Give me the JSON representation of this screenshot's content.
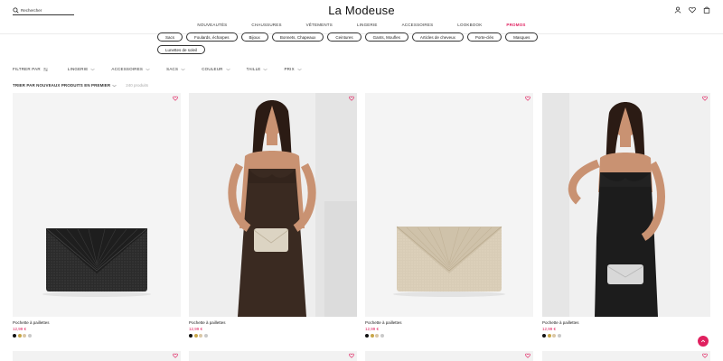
{
  "header": {
    "search_placeholder": "Rechercher",
    "logo": "La Modeuse",
    "nav": [
      "NOUVEAUTÉS",
      "CHAUSSURES",
      "VÊTEMENTS",
      "LINGERIE",
      "ACCESSOIRES",
      "LOOKBOOK",
      "PROMOS"
    ],
    "icons": [
      "account-icon",
      "heart-icon",
      "bag-icon"
    ]
  },
  "categories": [
    "Sacs",
    "Foulards, écharpes",
    "Bijoux",
    "Bonnets, Chapeaux",
    "Ceintures",
    "Gants, Moufles",
    "Articles de cheveux",
    "Porte-clés",
    "Masques",
    "Lunettes de soleil"
  ],
  "filters": {
    "label": "FILTRER PAR",
    "items": [
      "LINGERIE",
      "ACCESSOIRES",
      "SACS",
      "COULEUR",
      "TAILLE",
      "PRIX"
    ]
  },
  "sort": {
    "label": "TRIER PAR NOUVEAUX PRODUITS EN PREMIER",
    "count": "240 produits"
  },
  "products": [
    {
      "name": "Pochette à paillettes",
      "price": "12,99 €",
      "swatches": [
        "#111111",
        "#c8a648",
        "#d9c7a6",
        "#c9c9c9"
      ]
    },
    {
      "name": "Pochette à paillettes",
      "price": "12,99 €",
      "swatches": [
        "#111111",
        "#c8a648",
        "#d9c7a6",
        "#c9c9c9"
      ]
    },
    {
      "name": "Pochette à paillettes",
      "price": "12,99 €",
      "swatches": [
        "#111111",
        "#c8a648",
        "#d9c7a6",
        "#c9c9c9"
      ]
    },
    {
      "name": "Pochette à paillettes",
      "price": "12,99 €",
      "swatches": [
        "#111111",
        "#c8a648",
        "#d9c7a6",
        "#c9c9c9"
      ]
    }
  ],
  "colors": {
    "accent": "#e0205f",
    "text": "#111111",
    "muted": "#aaaaaa"
  }
}
